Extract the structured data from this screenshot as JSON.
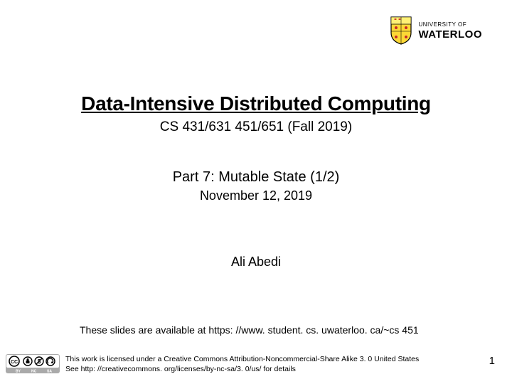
{
  "logo": {
    "university": "UNIVERSITY OF",
    "name": "WATERLOO"
  },
  "title": "Data-Intensive Distributed Computing",
  "courseCode": "CS 431/631 451/651 (Fall 2019)",
  "partTitle": "Part 7: Mutable State (1/2)",
  "partDate": "November 12, 2019",
  "author": "Ali Abedi",
  "availability": "These slides are available at https: //www. student. cs. uwaterloo. ca/~cs 451",
  "license": {
    "line1": "This work is licensed under a Creative Commons Attribution-Noncommercial-Share Alike 3. 0 United States",
    "line2": "See http: //creativecommons. org/licenses/by-nc-sa/3. 0/us/ for details"
  },
  "pageNumber": "1"
}
